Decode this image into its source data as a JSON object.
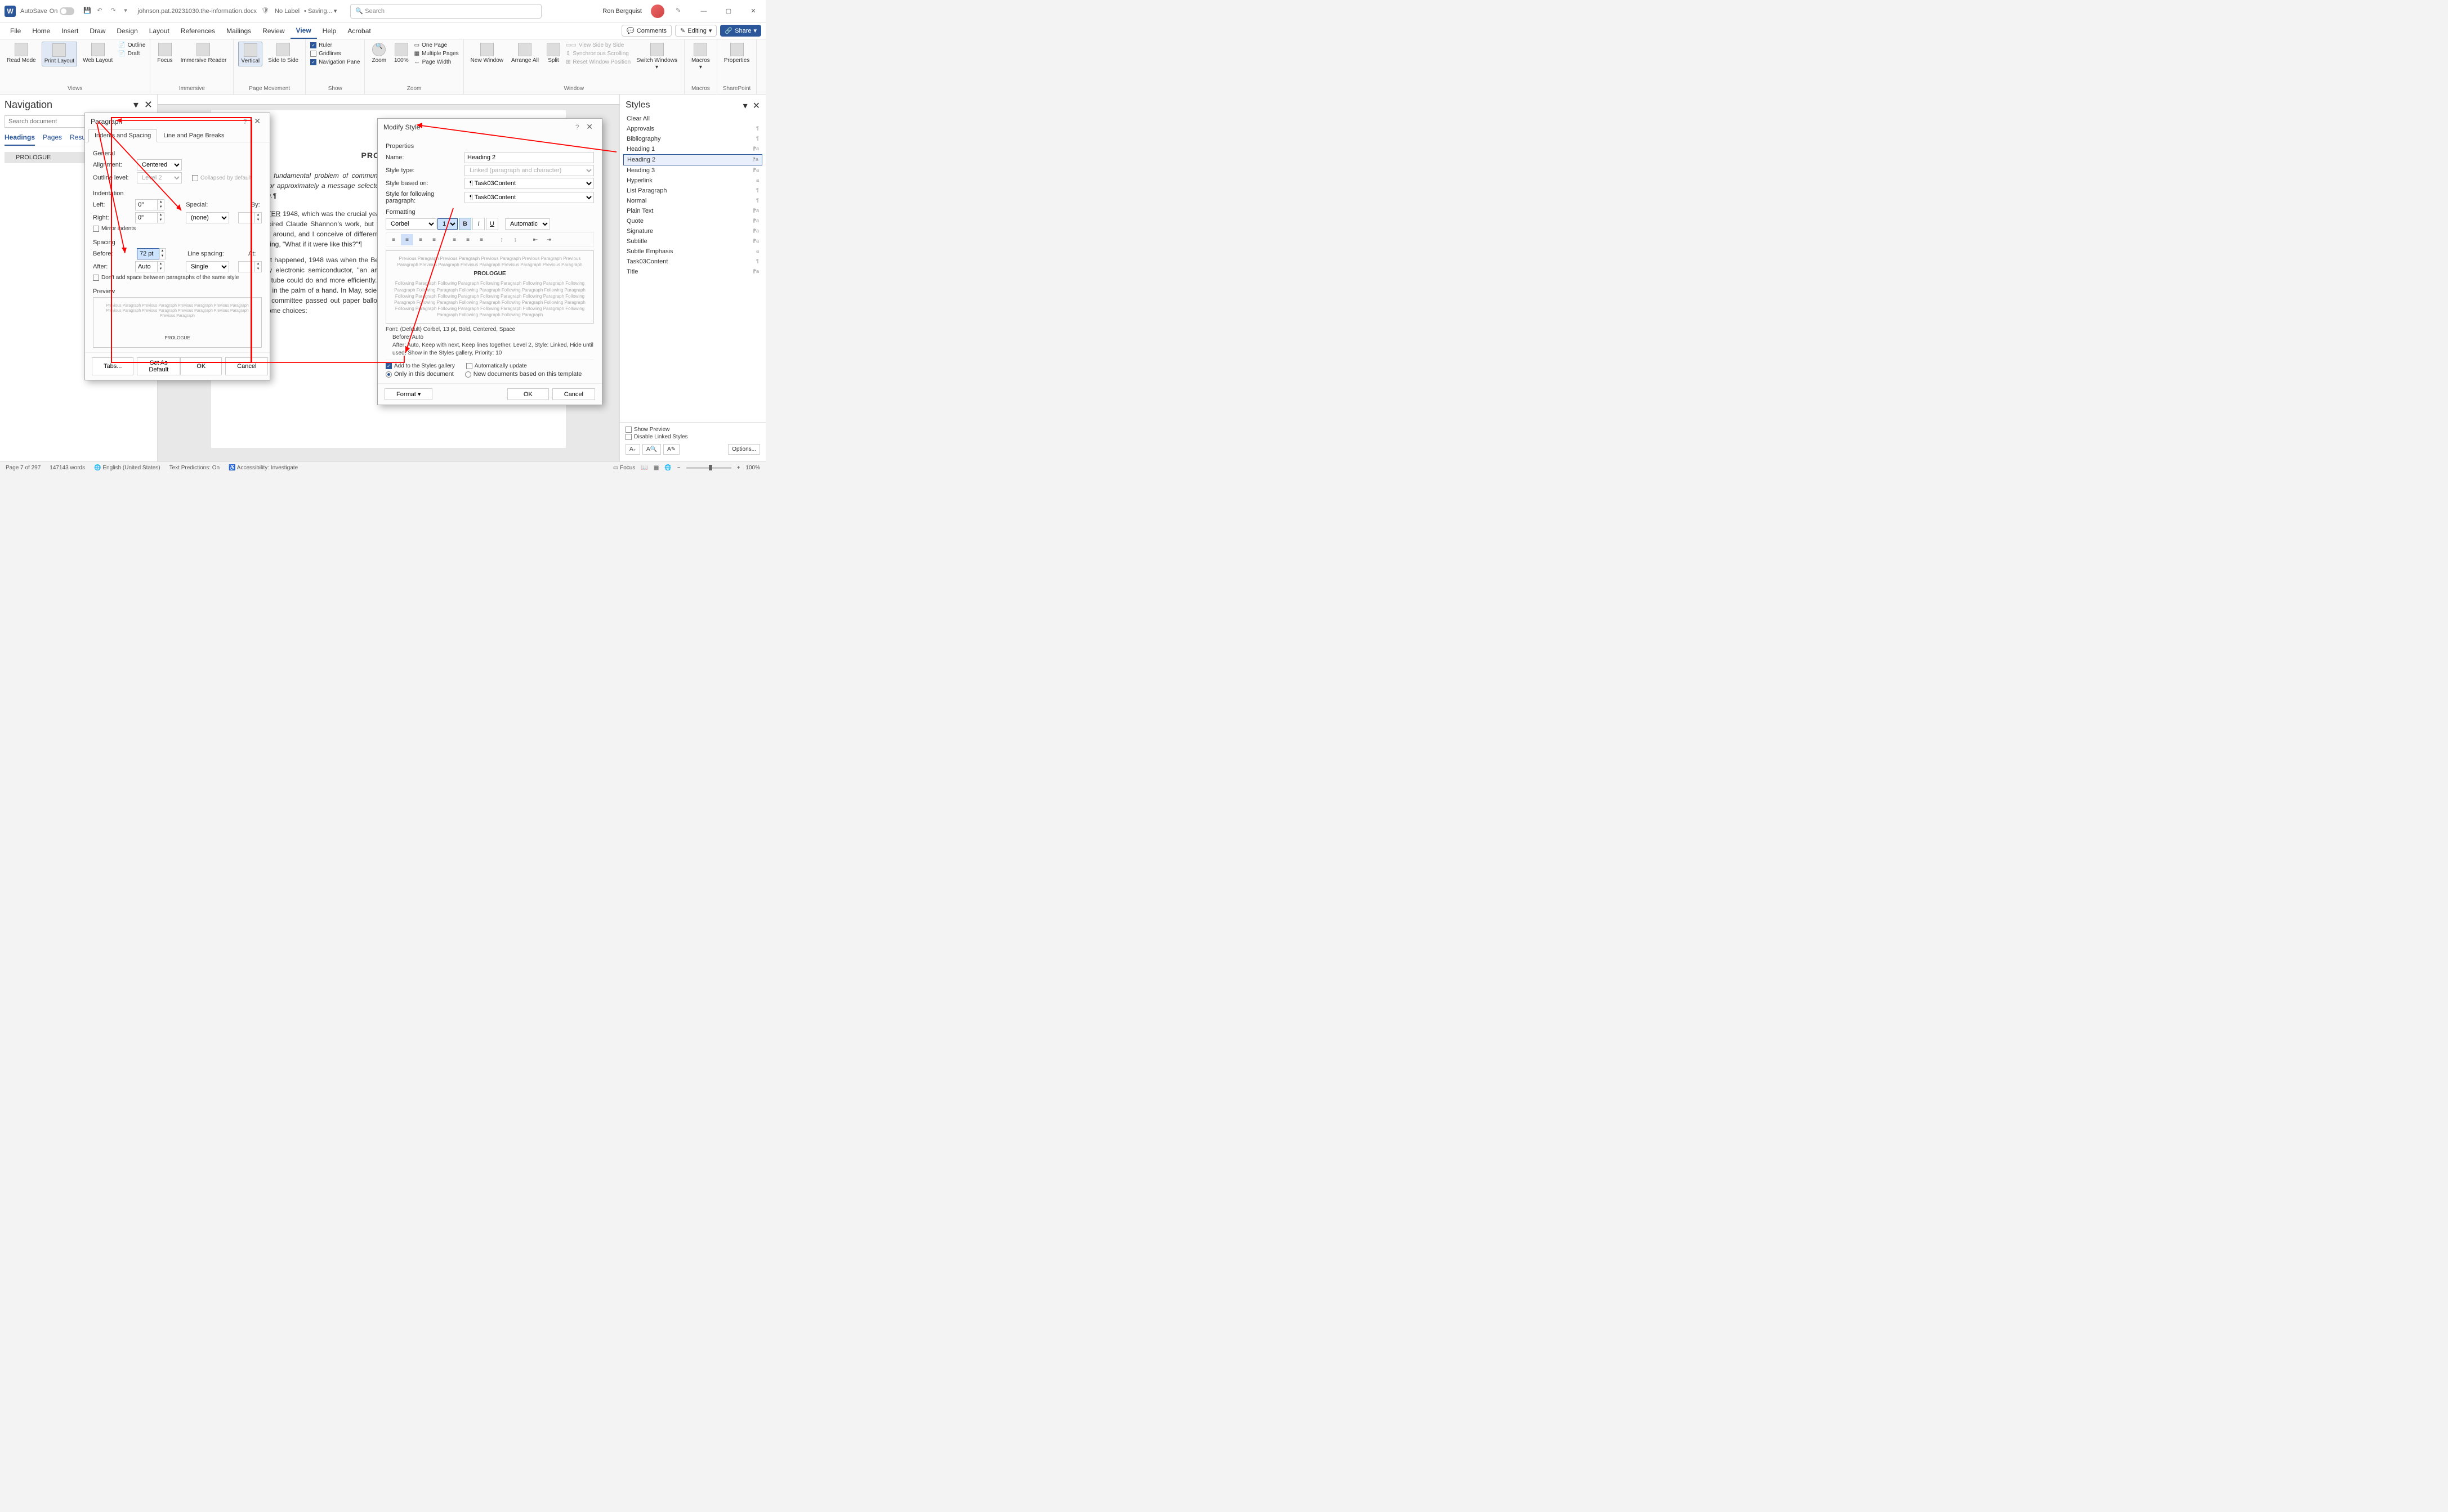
{
  "titlebar": {
    "autosave": "AutoSave",
    "autosave_state": "On",
    "doc_name": "johnson.pat.20231030.the-information.docx",
    "label_status": "No Label",
    "saving": "Saving...",
    "search_placeholder": "Search",
    "user": "Ron Bergquist"
  },
  "tabs": {
    "file": "File",
    "home": "Home",
    "insert": "Insert",
    "draw": "Draw",
    "design": "Design",
    "layout": "Layout",
    "references": "References",
    "mailings": "Mailings",
    "review": "Review",
    "view": "View",
    "help": "Help",
    "acrobat": "Acrobat",
    "comments": "Comments",
    "editing": "Editing",
    "share": "Share"
  },
  "ribbon": {
    "views": {
      "label": "Views",
      "read": "Read Mode",
      "print": "Print Layout",
      "web": "Web Layout",
      "outline": "Outline",
      "draft": "Draft"
    },
    "immersive": {
      "label": "Immersive",
      "focus": "Focus",
      "reader": "Immersive Reader"
    },
    "pagemove": {
      "label": "Page Movement",
      "vertical": "Vertical",
      "side": "Side to Side"
    },
    "show": {
      "label": "Show",
      "ruler": "Ruler",
      "gridlines": "Gridlines",
      "navpane": "Navigation Pane"
    },
    "zoom": {
      "label": "Zoom",
      "zoom": "Zoom",
      "hundred": "100%",
      "one": "One Page",
      "multi": "Multiple Pages",
      "width": "Page Width"
    },
    "window": {
      "label": "Window",
      "new": "New Window",
      "arrange": "Arrange All",
      "split": "Split",
      "sidebyside": "View Side by Side",
      "syncscroll": "Synchronous Scrolling",
      "resetpos": "Reset Window Position",
      "switch": "Switch Windows"
    },
    "macros": {
      "label": "Macros",
      "macros": "Macros"
    },
    "sharepoint": {
      "label": "SharePoint",
      "props": "Properties"
    }
  },
  "navpane": {
    "title": "Navigation",
    "search_placeholder": "Search document",
    "headings": "Headings",
    "pages": "Pages",
    "results": "Results",
    "item1": "PROLOGUE"
  },
  "document": {
    "heading": "PROLOGUE¶",
    "para1": "The fundamental problem of communication is that of reproducing at one point either exactly or approximately a message selected at another point. Frequently the messages have meaning.¶",
    "para2a": "AFTER",
    "para2": " 1948, which was the crucial year, people thought they could see the clear purpose that inspired Claude Shannon's work, but that was hindsight. He saw it differently: My mind wanders around, and I conceive of different things day and night. Like a science-fiction writer, I'm thinking, \"What if it were like this?\"¶",
    "para3": "As it happened, 1948 was when the Bell Telephone Laboratories announced the invention of a tiny electronic semiconductor, \"an amazingly simple device\" that could do anything a vacuum tube could do and more efficiently. It was a crystalline sliver, so small that a hundred would fit in the palm of a hand. In May, scientists formed a committee to come up with a name, and the committee passed out paper ballots to senior engineers in Murray Hill, New Jersey, listing some choices:"
  },
  "styles": {
    "title": "Styles",
    "clear": "Clear All",
    "items": [
      {
        "name": "Approvals",
        "m": "¶"
      },
      {
        "name": "Bibliography",
        "m": "¶"
      },
      {
        "name": "Heading 1",
        "m": "⁋a"
      },
      {
        "name": "Heading 2",
        "m": "⁋a"
      },
      {
        "name": "Heading 3",
        "m": "⁋a"
      },
      {
        "name": "Hyperlink",
        "m": "a"
      },
      {
        "name": "List Paragraph",
        "m": "¶"
      },
      {
        "name": "Normal",
        "m": "¶"
      },
      {
        "name": "Plain Text",
        "m": "⁋a"
      },
      {
        "name": "Quote",
        "m": "⁋a"
      },
      {
        "name": "Signature",
        "m": "⁋a"
      },
      {
        "name": "Subtitle",
        "m": "⁋a"
      },
      {
        "name": "Subtle Emphasis",
        "m": "a"
      },
      {
        "name": "Task03Content",
        "m": "¶"
      },
      {
        "name": "Title",
        "m": "⁋a"
      }
    ],
    "show_preview": "Show Preview",
    "disable_linked": "Disable Linked Styles",
    "options": "Options..."
  },
  "paragraph_dlg": {
    "title": "Paragraph",
    "tab1": "Indents and Spacing",
    "tab2": "Line and Page Breaks",
    "general": "General",
    "alignment": "Alignment:",
    "alignment_v": "Centered",
    "outline": "Outline level:",
    "outline_v": "Level 2",
    "collapsed": "Collapsed by default",
    "indentation": "Indentation",
    "left": "Left:",
    "left_v": "0\"",
    "right": "Right:",
    "right_v": "0\"",
    "special": "Special:",
    "special_v": "(none)",
    "by": "By:",
    "mirror": "Mirror indents",
    "spacing": "Spacing",
    "before": "Before:",
    "before_v": "72 pt",
    "after": "After:",
    "after_v": "Auto",
    "linespacing": "Line spacing:",
    "linespacing_v": "Single",
    "at": "At:",
    "dontadd": "Don't add space between paragraphs of the same style",
    "preview": "Preview",
    "preview_text": "Previous Paragraph Previous Paragraph Previous Paragraph Previous Paragraph Previous Paragraph Previous Paragraph Previous Paragraph Previous Paragraph Previous Paragraph",
    "preview_main": "PROLOGUE",
    "tabs_btn": "Tabs...",
    "default_btn": "Set As Default",
    "ok": "OK",
    "cancel": "Cancel"
  },
  "modify_dlg": {
    "title": "Modify Style",
    "properties": "Properties",
    "name": "Name:",
    "name_v": "Heading 2",
    "type": "Style type:",
    "type_v": "Linked (paragraph and character)",
    "based": "Style based on:",
    "based_v": "¶ Task03Content",
    "following": "Style for following paragraph:",
    "following_v": "¶ Task03Content",
    "formatting": "Formatting",
    "font": "Corbel",
    "size": "13",
    "color": "Automatic",
    "preview_prev": "Previous Paragraph Previous Paragraph Previous Paragraph Previous Paragraph Previous Paragraph Previous Paragraph Previous Paragraph Previous Paragraph Previous Paragraph",
    "preview_main": "PROLOGUE",
    "preview_next": "Following Paragraph Following Paragraph Following Paragraph Following Paragraph Following Paragraph Following Paragraph Following Paragraph Following Paragraph Following Paragraph Following Paragraph Following Paragraph Following Paragraph Following Paragraph Following Paragraph Following Paragraph Following Paragraph Following Paragraph Following Paragraph Following Paragraph Following Paragraph Following Paragraph Following Paragraph Following Paragraph Following Paragraph Following Paragraph",
    "desc1": "Font: (Default) Corbel, 13 pt, Bold, Centered, Space",
    "desc2": "Before: Auto",
    "desc3": "After: Auto, Keep with next, Keep lines together, Level 2, Style: Linked, Hide until used, Show in the Styles gallery, Priority: 10",
    "addgallery": "Add to the Styles gallery",
    "autoupdate": "Automatically update",
    "onlydoc": "Only in this document",
    "newdocs": "New documents based on this template",
    "format": "Format",
    "ok": "OK",
    "cancel": "Cancel"
  },
  "statusbar": {
    "page": "Page 7 of 297",
    "words": "147143 words",
    "lang": "English (United States)",
    "predictions": "Text Predictions: On",
    "accessibility": "Accessibility: Investigate",
    "focus": "Focus",
    "zoom": "100%"
  }
}
